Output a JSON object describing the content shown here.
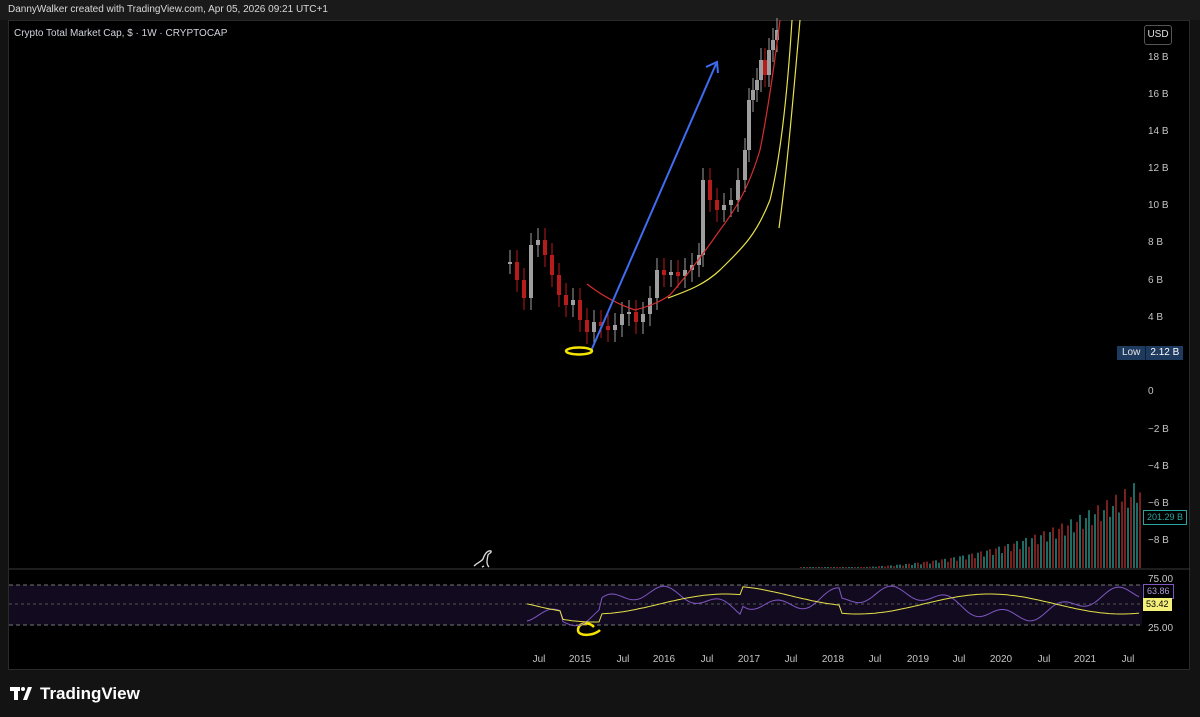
{
  "header": {
    "credit": "DannyWalker created with TradingView.com, Apr 05, 2026 09:21 UTC+1"
  },
  "chart_header": {
    "symbol": "Crypto Total Market Cap, $ · 1W · CRYPTOCAP",
    "currency_button": "USD"
  },
  "price_axis": {
    "labels": [
      "18 B",
      "16 B",
      "14 B",
      "12 B",
      "10 B",
      "8 B",
      "6 B",
      "4 B",
      "0",
      "−2 B",
      "−4 B",
      "−6 B",
      "−8 B"
    ]
  },
  "low_marker": {
    "label": "Low",
    "value": "2.12 B"
  },
  "volume_marker": {
    "value": "201.29 B"
  },
  "rsi": {
    "upper_level": "75.00",
    "lower_level": "25.00",
    "rsi_value": "63.86",
    "ma_value": "53.42"
  },
  "time_axis": {
    "labels": [
      "Jul",
      "2015",
      "Jul",
      "2016",
      "Jul",
      "2017",
      "Jul",
      "2018",
      "Jul",
      "2019",
      "Jul",
      "2020",
      "Jul",
      "2021",
      "Jul"
    ]
  },
  "brand": {
    "name": "TradingView"
  },
  "colors": {
    "up": "#9e9e9e",
    "down": "#b71c1c",
    "ma_red": "#d32f2f",
    "ma_yellow": "#e6e24a",
    "arrow": "#3f6df2",
    "rsi": "#7e57c2",
    "rsi_ma": "#e6e24a"
  },
  "chart_data": {
    "type": "line",
    "title": "Crypto Total Market Cap",
    "y_axis_unit": "B USD",
    "price_approx": {
      "x": [
        "2014-03",
        "2014-06",
        "2014-09",
        "2015-01",
        "2015-04",
        "2015-07",
        "2015-10",
        "2016-01",
        "2016-04",
        "2016-07",
        "2016-10",
        "2017-01",
        "2017-03"
      ],
      "y": [
        7.5,
        8.0,
        6.0,
        3.0,
        3.5,
        4.0,
        4.0,
        7.0,
        7.5,
        11.0,
        11.0,
        15.0,
        20.0
      ]
    },
    "low": 2.12,
    "rsi_levels": [
      25,
      75
    ],
    "rsi_last": 63.86,
    "rsi_ma_last": 53.42,
    "volume_last": "201.29 B"
  }
}
